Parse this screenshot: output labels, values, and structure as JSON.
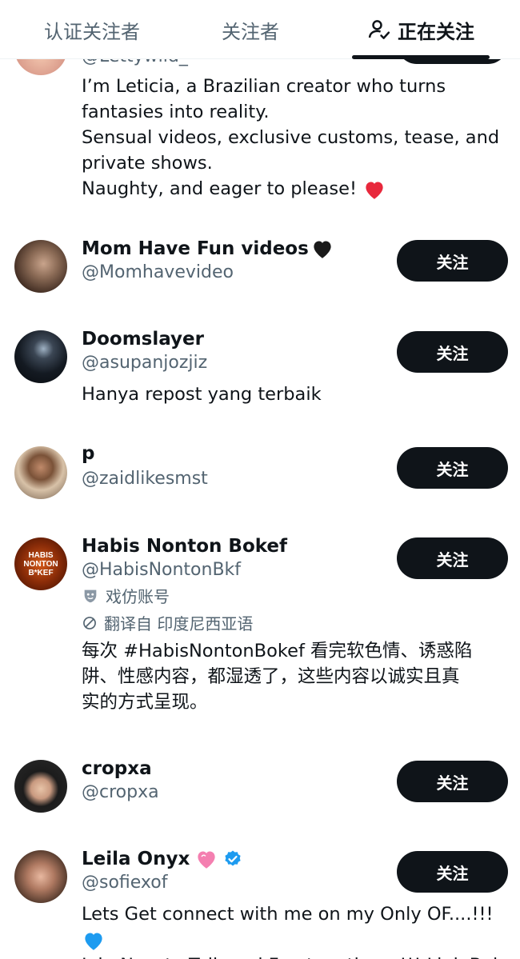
{
  "tabs": [
    {
      "label": "认证关注者"
    },
    {
      "label": "关注者"
    },
    {
      "label": "正在关注"
    }
  ],
  "users": [
    {
      "handle": "@Lettywild_",
      "bio": [
        "I’m Leticia, a Brazilian creator who turns",
        "fantasies into reality.",
        "Sensual videos, exclusive customs, tease, and",
        "private shows.",
        "Naughty, and eager to please!"
      ]
    },
    {
      "name": "Mom Have Fun videos",
      "handle": "@Momhavevideo",
      "follow_label": "关注"
    },
    {
      "name": "Doomslayer",
      "handle": "@asupanjozjiz",
      "follow_label": "关注",
      "bio": "Hanya repost yang terbaik"
    },
    {
      "name": "p",
      "handle": "@zaidlikesmst",
      "follow_label": "关注"
    },
    {
      "name": "Habis Nonton Bokef",
      "handle": "@HabisNontonBkf",
      "follow_label": "关注",
      "parody_label": "戏仿账号",
      "translated_label": "翻译自 印度尼西亚语",
      "avatar_text": [
        "HABIS",
        "NONTON",
        "B*KEF"
      ],
      "bio": [
        "每次 #HabisNontonBokef 看完软色情、诱惑陷",
        "阱、性感内容，都湿透了，这些内容以诚实且真",
        "实的方式呈现。"
      ]
    },
    {
      "name": "cropxa",
      "handle": "@cropxa",
      "follow_label": "关注"
    },
    {
      "name": "Leila Onyx",
      "handle": "@sofiexof",
      "follow_label": "关注",
      "bio": [
        "Lets Get connect with me on my Only OF....!!!",
        "Join Now to Talk and Fun together...!!! Link Below"
      ]
    }
  ],
  "colors": {
    "text": "#0f1419",
    "secondary": "#536471",
    "button_bg": "#0f1419",
    "verified": "#1d9bf0",
    "heart_red": "#e0245e",
    "heart_blue": "#1d9bf0",
    "heart_pink": "#f47fb0"
  }
}
